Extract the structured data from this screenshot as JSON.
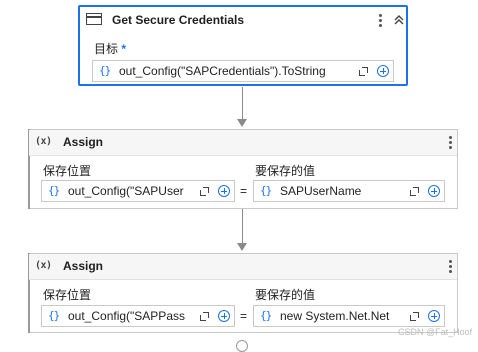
{
  "get_credentials": {
    "title": "Get Secure Credentials",
    "target_label": "目标",
    "required_mark": "*",
    "target_value": "out_Config(\"SAPCredentials\").ToString"
  },
  "assign_1": {
    "title": "Assign",
    "icon_text": "(x)",
    "left_label": "保存位置",
    "right_label": "要保存的值",
    "left_value": "out_Config(\"SAPUser",
    "right_value": "SAPUserName",
    "equals": "="
  },
  "assign_2": {
    "title": "Assign",
    "icon_text": "(x)",
    "left_label": "保存位置",
    "right_label": "要保存的值",
    "left_value": "out_Config(\"SAPPass",
    "right_value": "new System.Net.Net",
    "equals": "="
  },
  "common": {
    "braces": "{}"
  },
  "watermark": "CSDN @Fat_Hoof"
}
